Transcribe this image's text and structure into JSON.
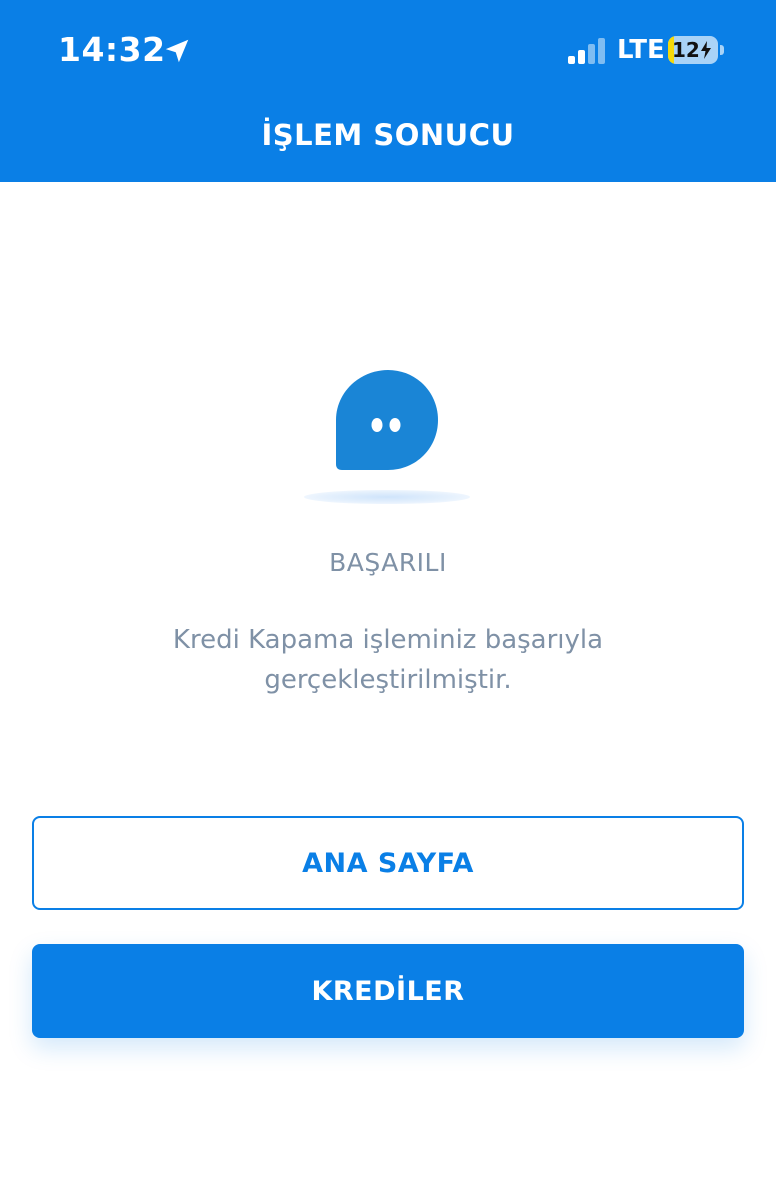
{
  "status_bar": {
    "time": "14:32",
    "network": "LTE",
    "battery_level": "12",
    "battery_fill_percent": 12
  },
  "header": {
    "title": "İŞLEM SONUCU"
  },
  "result": {
    "title": "BAŞARILI",
    "message": "Kredi Kapama işleminiz başarıyla gerçekleştirilmiştir."
  },
  "buttons": {
    "home_label": "ANA SAYFA",
    "loans_label": "KREDİLER"
  },
  "colors": {
    "brand_blue": "#0a7fe6",
    "mascot_blue": "#1a85d6",
    "muted_text": "#7f91a6"
  },
  "icons": {
    "location": "location-arrow-icon",
    "signal": "cellular-signal-icon",
    "battery": "battery-charging-icon",
    "mascot": "chat-bubble-mascot-icon"
  }
}
